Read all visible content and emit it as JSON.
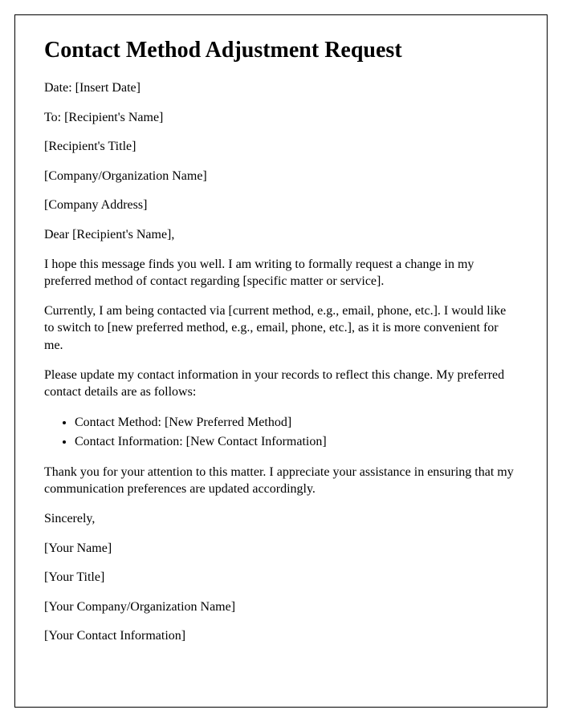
{
  "title": "Contact Method Adjustment Request",
  "header": {
    "date": "Date: [Insert Date]",
    "to": "To: [Recipient's Name]",
    "recipientTitle": "[Recipient's Title]",
    "company": "[Company/Organization Name]",
    "address": "[Company Address]"
  },
  "salutation": "Dear [Recipient's Name],",
  "body": {
    "p1": "I hope this message finds you well. I am writing to formally request a change in my preferred method of contact regarding [specific matter or service].",
    "p2": "Currently, I am being contacted via [current method, e.g., email, phone, etc.]. I would like to switch to [new preferred method, e.g., email, phone, etc.], as it is more convenient for me.",
    "p3": "Please update my contact information in your records to reflect this change. My preferred contact details are as follows:",
    "p4": "Thank you for your attention to this matter. I appreciate your assistance in ensuring that my communication preferences are updated accordingly."
  },
  "list": {
    "item1": "Contact Method: [New Preferred Method]",
    "item2": "Contact Information: [New Contact Information]"
  },
  "closing": {
    "signoff": "Sincerely,",
    "name": "[Your Name]",
    "title": "[Your Title]",
    "company": "[Your Company/Organization Name]",
    "contact": "[Your Contact Information]"
  }
}
